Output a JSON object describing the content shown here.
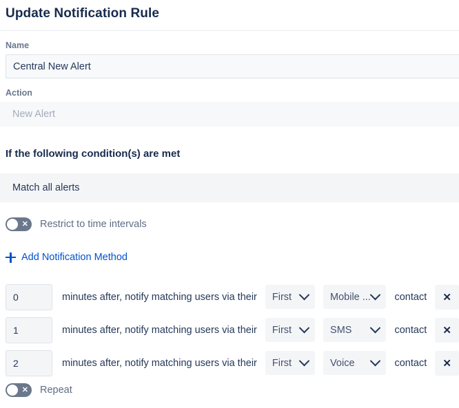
{
  "header": {
    "title": "Update Notification Rule"
  },
  "name_field": {
    "label": "Name",
    "value": "Central New Alert",
    "placeholder": "Name"
  },
  "action_field": {
    "label": "Action",
    "value": "New Alert"
  },
  "conditions": {
    "heading": "If the following condition(s) are met",
    "match_text": "Match all alerts"
  },
  "restrict_toggle": {
    "label": "Restrict to time intervals",
    "state": "off",
    "mark": "✕"
  },
  "add_method": {
    "label": "Add Notification Method",
    "icon": "plus-icon"
  },
  "methods": {
    "middle_text": "minutes after, notify matching users via their",
    "contact_text": "contact",
    "remove_glyph": "✕",
    "rows": [
      {
        "minutes": "0",
        "ordinal": "First",
        "channel": "Mobile ..."
      },
      {
        "minutes": "1",
        "ordinal": "First",
        "channel": "SMS"
      },
      {
        "minutes": "2",
        "ordinal": "First",
        "channel": "Voice"
      }
    ]
  },
  "repeat_toggle": {
    "label": "Repeat",
    "state": "off",
    "mark": "✕"
  },
  "colors": {
    "accent_link": "#0052cc",
    "title_text": "#172b4d",
    "body_text": "#253858",
    "muted_text": "#6b778c",
    "field_bg": "#f4f5f7",
    "input_bg": "#f7f9fb",
    "toggle_off_bg": "#6b778c",
    "border": "#dfe2e8"
  }
}
